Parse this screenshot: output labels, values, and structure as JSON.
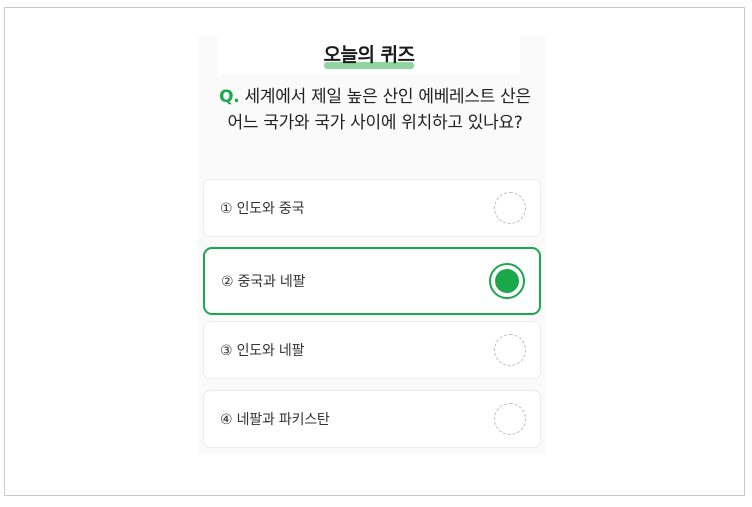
{
  "quiz": {
    "title": "오늘의 퀴즈",
    "question_prefix": "Q.",
    "question_text": "세계에서 제일 높은 산인 에베레스트 산은 어느 국가와 국가 사이에 위치하고 있나요?",
    "options": [
      {
        "label": "① 인도와 중국",
        "selected": false
      },
      {
        "label": "② 중국과 네팔",
        "selected": true
      },
      {
        "label": "③ 인도와 네팔",
        "selected": false
      },
      {
        "label": "④ 네팔과 파키스탄",
        "selected": false
      }
    ]
  },
  "colors": {
    "accent": "#1ba84a",
    "title_highlight": "#8fd6a2"
  }
}
